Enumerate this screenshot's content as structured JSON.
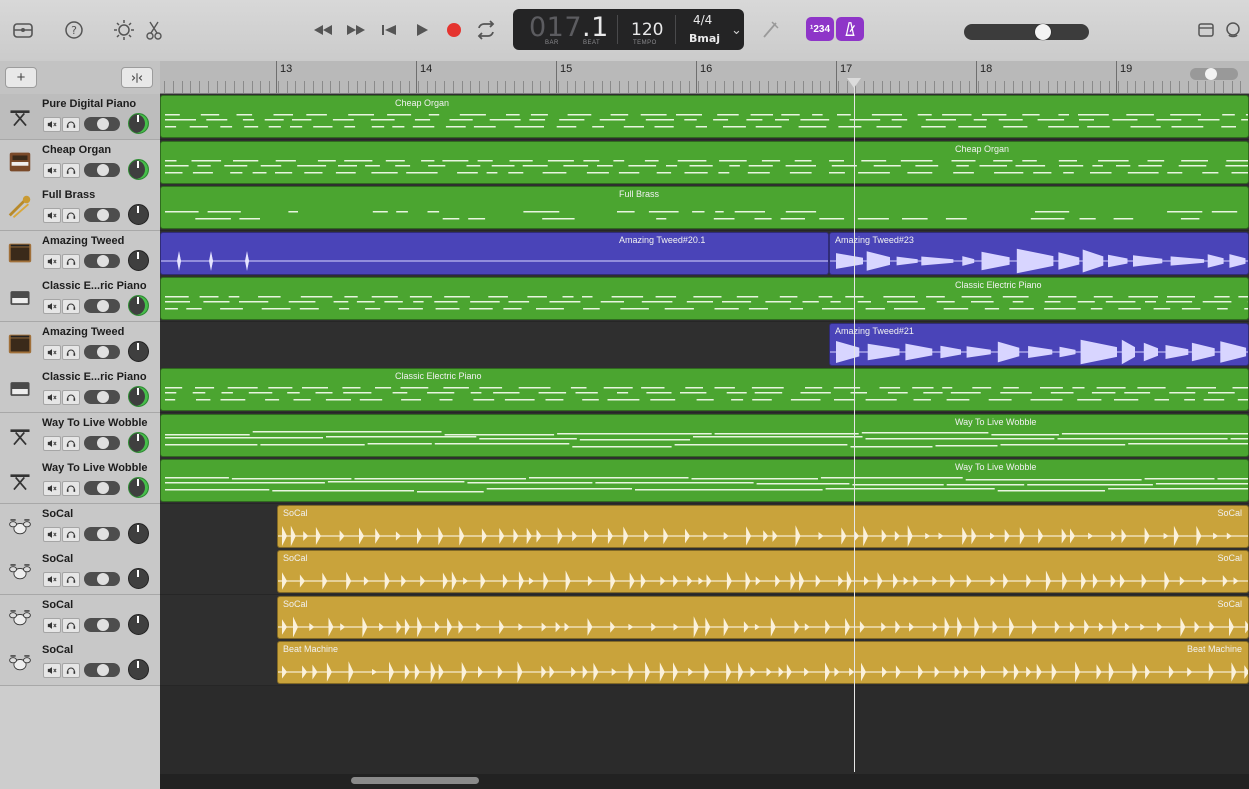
{
  "lcd": {
    "bar": "017",
    "beat_sep": ".",
    "beat": "1",
    "bar_caption": "BAR",
    "beat_caption": "BEAT",
    "tempo": "120",
    "tempo_caption": "TEMPO",
    "time_signature": "4/4",
    "key": "Bmaj"
  },
  "toolbar": {
    "count_in_label": "¹234",
    "left_icons": [
      "library-icon",
      "help-icon",
      "smart-controls-icon",
      "editors-icon"
    ],
    "transport": [
      "rewind-icon",
      "fast-forward-icon",
      "go-to-beginning-icon",
      "play-icon",
      "record-icon",
      "cycle-icon"
    ],
    "right_icons": [
      "notepad-icon",
      "loop-browser-icon"
    ]
  },
  "ruler": {
    "bars": [
      "13",
      "14",
      "15",
      "16",
      "17",
      "18",
      "19"
    ]
  },
  "tracks": [
    {
      "name": "Pure Digital Piano",
      "icon": "keyboard-stand-icon",
      "pan_green": true
    },
    {
      "name": "Cheap Organ",
      "icon": "organ-icon",
      "pan_green": true
    },
    {
      "name": "Full Brass",
      "icon": "brass-icon",
      "pan_green": false
    },
    {
      "name": "Amazing Tweed",
      "icon": "guitar-amp-icon",
      "pan_green": false
    },
    {
      "name": "Classic E...ric Piano",
      "icon": "electric-piano-icon",
      "pan_green": true
    },
    {
      "name": "Amazing Tweed",
      "icon": "guitar-amp-icon",
      "pan_green": false
    },
    {
      "name": "Classic E...ric Piano",
      "icon": "electric-piano-icon",
      "pan_green": true
    },
    {
      "name": "Way To Live Wobble",
      "icon": "keyboard-stand-icon",
      "pan_green": true
    },
    {
      "name": "Way To Live Wobble",
      "icon": "keyboard-stand-icon",
      "pan_green": true
    },
    {
      "name": "SoCal",
      "icon": "drum-kit-icon",
      "pan_green": false
    },
    {
      "name": "SoCal",
      "icon": "drum-kit-icon",
      "pan_green": false
    },
    {
      "name": "SoCal",
      "icon": "drum-kit-icon",
      "pan_green": false
    },
    {
      "name": "SoCal",
      "icon": "drum-kit-icon",
      "pan_green": false
    }
  ],
  "regions": {
    "r0": "Cheap Organ",
    "r1": "Cheap Organ",
    "r2": "Full Brass",
    "r3a": "Amazing Tweed#20.1",
    "r3b": "Amazing Tweed#23",
    "r4": "Classic Electric Piano",
    "r5": "Amazing Tweed#21",
    "r6": "Classic Electric Piano",
    "r7": "Way To Live Wobble",
    "r8": "Way To Live Wobble",
    "r9": "SoCal",
    "r10": "SoCal",
    "r11": "SoCal",
    "r12": "Beat Machine"
  },
  "colors": {
    "midi_region": "#4ba530",
    "audio_region": "#4a44b8",
    "drummer_region": "#c9a33b",
    "record": "#e5342f",
    "count_in": "#8e35c8"
  }
}
